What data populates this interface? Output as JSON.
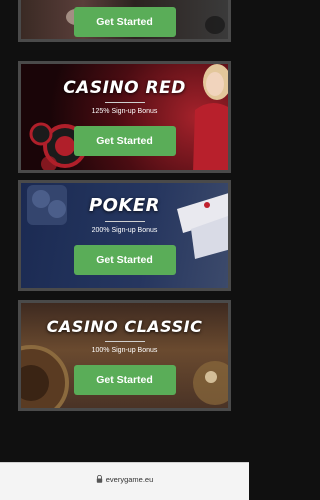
{
  "cards": [
    {
      "id": "top",
      "cta_label": "Get Started"
    },
    {
      "id": "casino_red",
      "title": "CASINO RED",
      "bonus": "125% Sign-up Bonus",
      "cta_label": "Get Started"
    },
    {
      "id": "poker",
      "title": "POKER",
      "bonus": "200% Sign-up Bonus",
      "cta_label": "Get Started"
    },
    {
      "id": "casino_classic",
      "title": "CASINO CLASSIC",
      "bonus": "100% Sign-up Bonus",
      "cta_label": "Get Started"
    }
  ],
  "browser": {
    "url": "everygame.eu",
    "lock_icon": "lock-icon"
  },
  "colors": {
    "cta_green": "#5aad58",
    "page_background": "#101010",
    "card_border": "#4a4a4a"
  }
}
